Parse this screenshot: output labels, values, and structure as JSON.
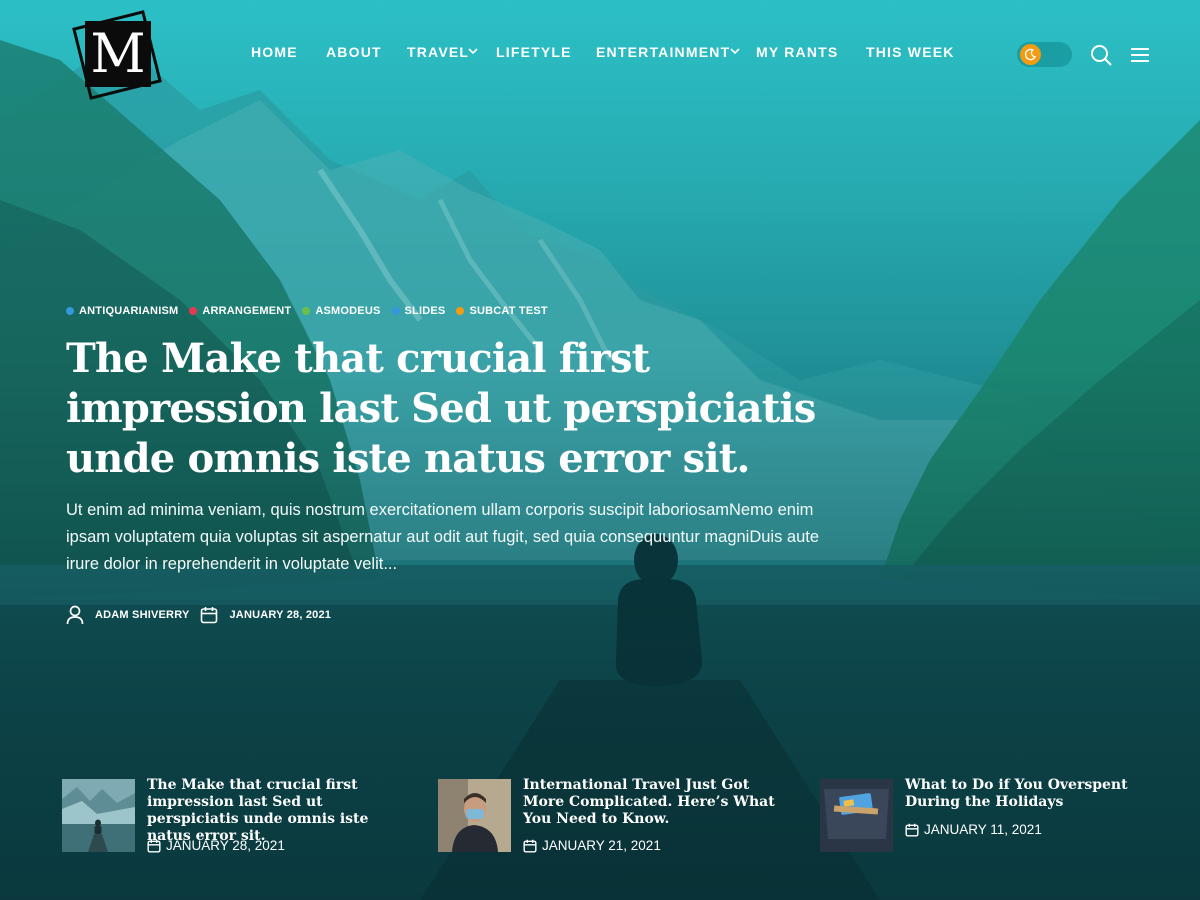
{
  "logo": {
    "letter": "M"
  },
  "nav": {
    "home": "HOME",
    "about": "ABOUT",
    "travel": "TRAVEL",
    "lifestyle": "LIFETYLE",
    "entertainment": "ENTERTAINMENT",
    "my_rants": "MY RANTS",
    "this_week": "THIS WEEK"
  },
  "icons": {
    "dark_mode_toggle": "moon-icon",
    "search": "search-icon",
    "menu": "hamburger-icon",
    "author": "user-icon",
    "date": "calendar-icon"
  },
  "colors": {
    "toggle_knob": "#f39c12",
    "tag_blue": "#3498db",
    "tag_red": "#e8384f",
    "tag_green": "#6cc04a",
    "tag_orange": "#f39c12"
  },
  "featured": {
    "tags": [
      {
        "label": "ANTIQUARIANISM",
        "color": "#3498db"
      },
      {
        "label": "ARRANGEMENT",
        "color": "#e8384f"
      },
      {
        "label": "ASMODEUS",
        "color": "#6cc04a"
      },
      {
        "label": "SLIDES",
        "color": "#3498db"
      },
      {
        "label": "SUBCAT TEST",
        "color": "#f39c12"
      }
    ],
    "title": "The Make that crucial first impression last Sed ut perspiciatis unde omnis iste natus error sit.",
    "excerpt": "Ut enim ad minima veniam, quis nostrum exercitationem ullam corporis suscipit laboriosamNemo enim ipsam voluptatem quia voluptas sit aspernatur aut odit aut fugit, sed quia consequuntur magniDuis aute irure dolor in reprehenderit in voluptate velit...",
    "author": "ADAM SHIVERRY",
    "date": "JANUARY 28, 2021"
  },
  "cards": [
    {
      "title": "The Make that crucial first impression last Sed ut perspiciatis unde omnis iste natus error sit.",
      "date": "JANUARY 28, 2021"
    },
    {
      "title": "International Travel Just Got More Complicated. Here’s What You Need to Know.",
      "date": "JANUARY 21, 2021"
    },
    {
      "title": "What to Do if You Overspent During the Holidays",
      "date": "JANUARY 11, 2021"
    }
  ]
}
